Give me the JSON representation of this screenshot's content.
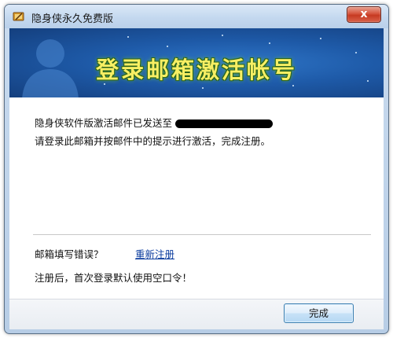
{
  "window": {
    "title": "隐身侠永久免费版",
    "close_label": "x"
  },
  "banner": {
    "title": "登录邮箱激活帐号"
  },
  "message": {
    "line1": "隐身侠软件版激活邮件已发送至",
    "line2": "请登录此邮箱并按邮件中的提示进行激活，完成注册。"
  },
  "error_prompt": {
    "label": "邮箱填写错误？",
    "link": "重新注册"
  },
  "note": "注册后，首次登录默认使用空口令！",
  "footer": {
    "done_label": "完成"
  }
}
